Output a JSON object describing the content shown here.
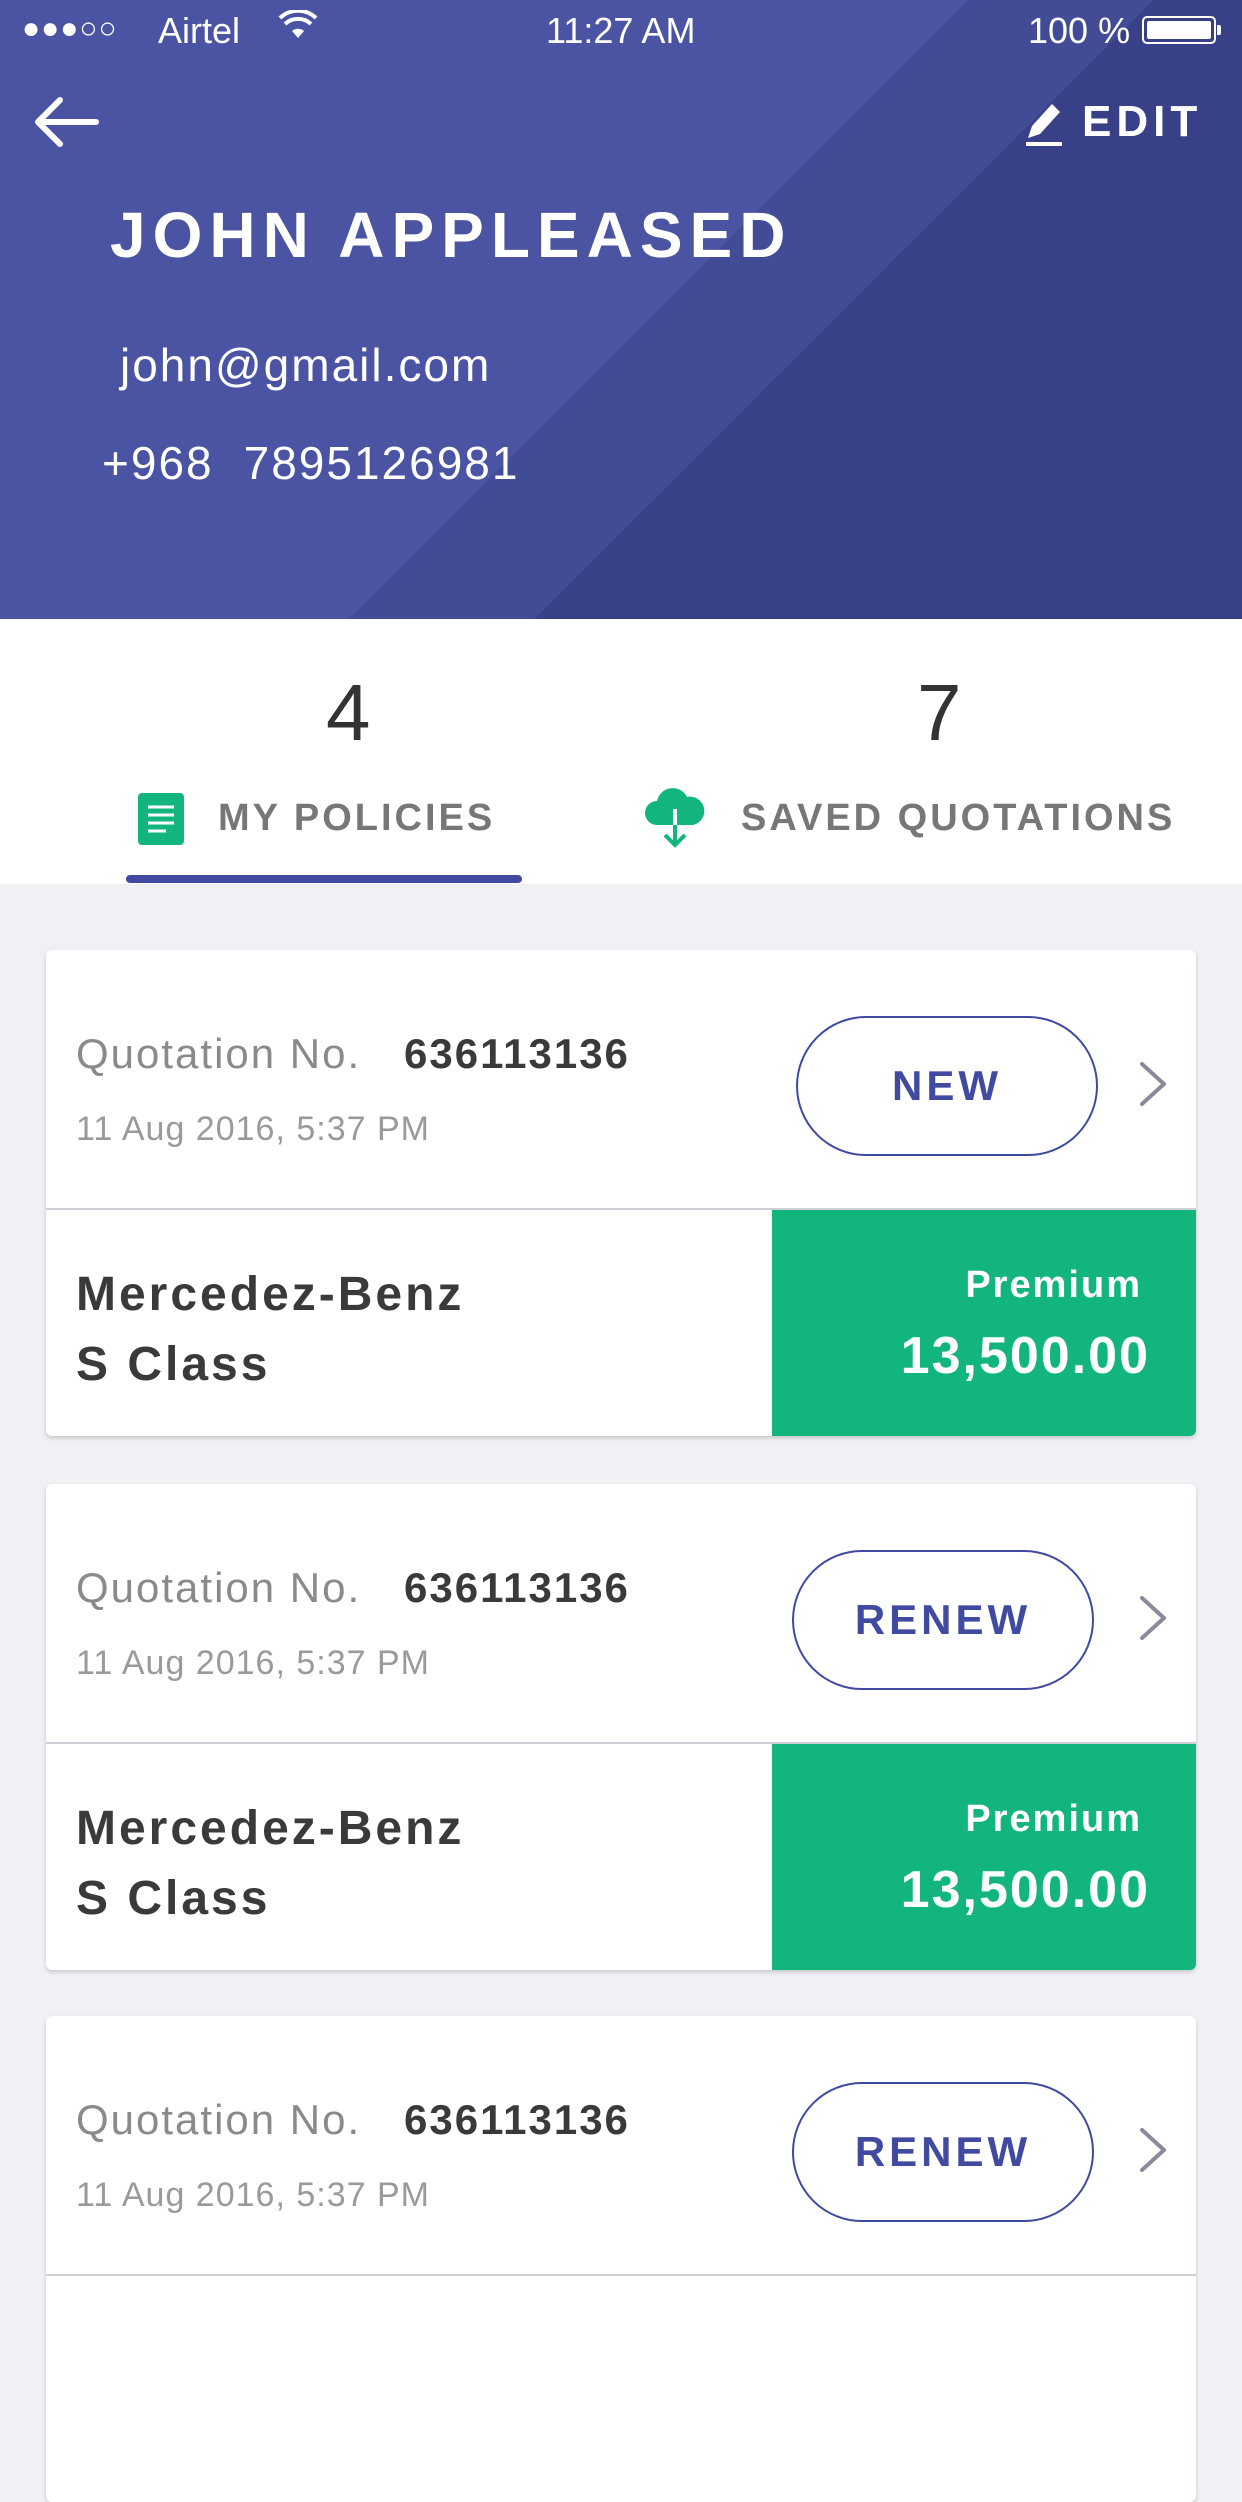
{
  "status_bar": {
    "signal": "●●●○○",
    "carrier": "Airtel",
    "time": "11:27 AM",
    "battery": "100 %"
  },
  "header": {
    "back_icon": "arrow-left-icon",
    "edit_icon": "pencil-icon",
    "edit_label": "EDIT",
    "name": "JOHN APPLEASED",
    "email": "john@gmail.com",
    "phone_code": "+968",
    "phone_number": "7895126981",
    "colors": {
      "background": "#4a54a2",
      "accent": "#3f4aa0"
    }
  },
  "tabs": [
    {
      "count": "4",
      "label": "MY POLICIES",
      "icon": "document-icon",
      "active": false
    },
    {
      "count": "7",
      "label": "SAVED QUOTATIONS",
      "icon": "cloud-download-icon",
      "active": true
    }
  ],
  "quotations": [
    {
      "label": "Quotation No.",
      "number": "636113136",
      "date": "11 Aug 2016, 5:37 PM",
      "status": "NEW",
      "vehicle_line1": "Mercedez-Benz",
      "vehicle_line2": "S Class",
      "premium_label": "Premium",
      "premium_value": "13,500.00"
    },
    {
      "label": "Quotation No.",
      "number": "636113136",
      "date": "11 Aug 2016, 5:37 PM",
      "status": "RENEW",
      "vehicle_line1": "Mercedez-Benz",
      "vehicle_line2": "S Class",
      "premium_label": "Premium",
      "premium_value": "13,500.00"
    },
    {
      "label": "Quotation No.",
      "number": "636113136",
      "date": "11 Aug 2016, 5:37 PM",
      "status": "RENEW"
    }
  ],
  "colors": {
    "premium_green": "#12b57c",
    "icon_green": "#12b57c"
  }
}
